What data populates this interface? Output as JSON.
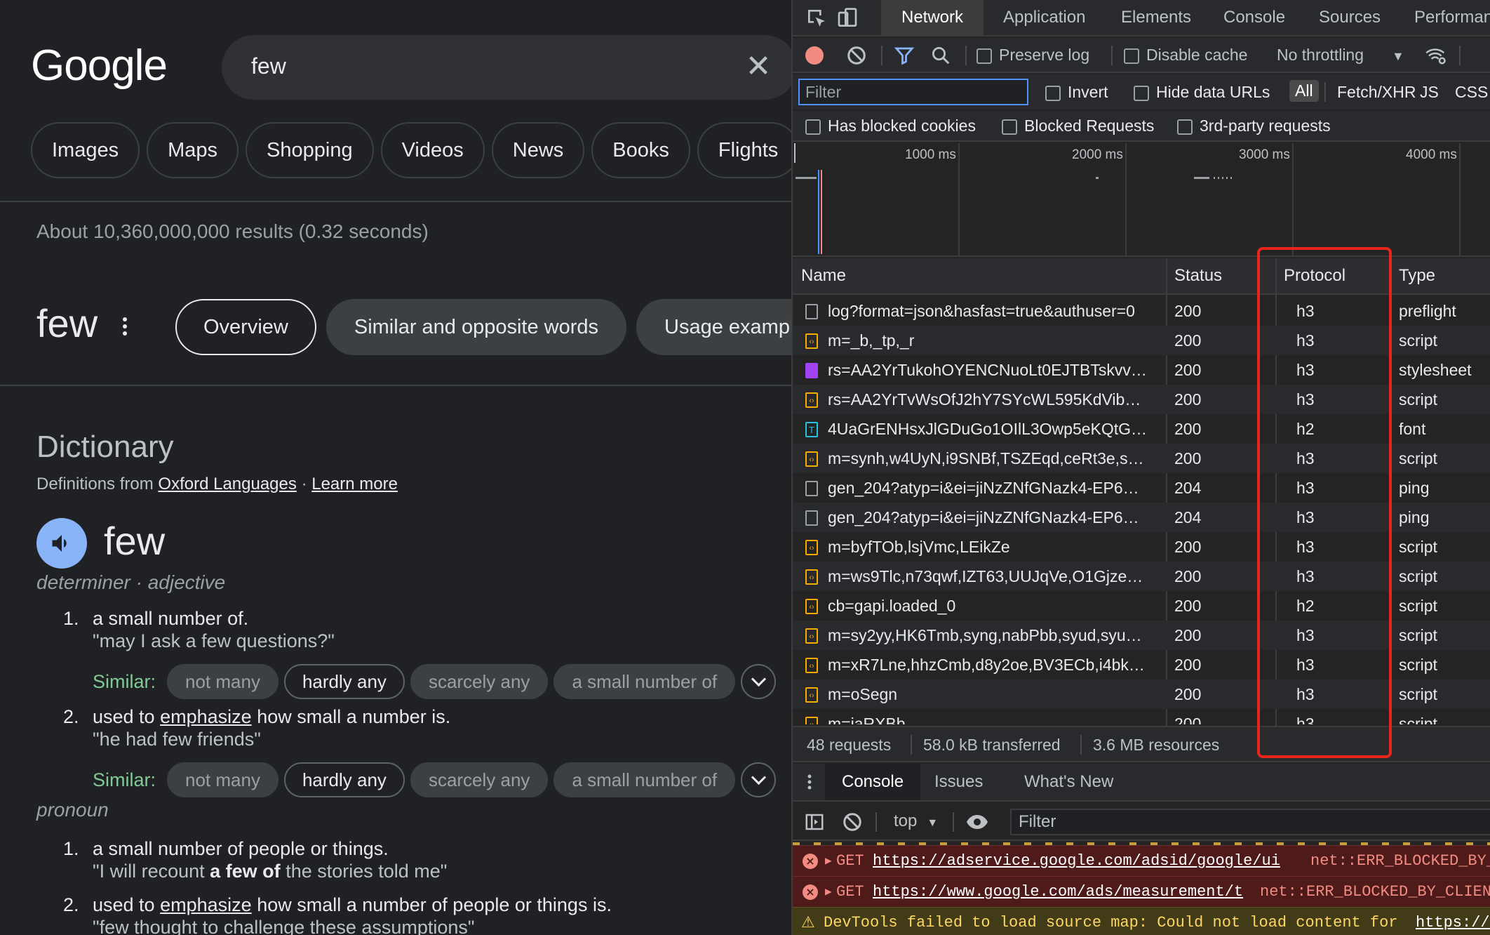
{
  "google": {
    "logo": "Google",
    "search_query": "few",
    "chips": [
      "Images",
      "Maps",
      "Shopping",
      "Videos",
      "News",
      "Books",
      "Flights"
    ],
    "stats": "About 10,360,000,000 results (0.32 seconds)",
    "term": "few",
    "term_tabs": [
      "Overview",
      "Similar and opposite words",
      "Usage examples"
    ],
    "dictionary": {
      "title": "Dictionary",
      "source_prefix": "Definitions from",
      "source_link": "Oxford Languages",
      "separator": "·",
      "learn_more": "Learn more",
      "word": "few",
      "pos1": "determiner · adjective",
      "def1_num": "1.",
      "def1": "a small number of.",
      "ex1": "\"may I ask a few questions?\"",
      "similar_label": "Similar:",
      "similar1": [
        "not many",
        "hardly any",
        "scarcely any",
        "a small number of"
      ],
      "def2_num": "2.",
      "def2_pre": "used to",
      "def2_link": "emphasize",
      "def2_post": "how small a number is.",
      "ex2": "\"he had few friends\"",
      "similar2": [
        "not many",
        "hardly any",
        "scarcely any",
        "a small number of"
      ],
      "pos2": "pronoun",
      "def3_num": "1.",
      "def3": "a small number of people or things.",
      "ex3_pre": "\"I will recount",
      "ex3_bold": "a few of",
      "ex3_post": "the stories told me\"",
      "def4_num": "2.",
      "def4_pre": "used to",
      "def4_link": "emphasize",
      "def4_post": "how small a number of people or things is.",
      "ex4": "\"few thought to challenge these assumptions\""
    }
  },
  "devtools": {
    "tabs": [
      "Network",
      "Application",
      "Elements",
      "Console",
      "Sources",
      "Performan"
    ],
    "active_tab": "Network",
    "toolbar": {
      "preserve_log": "Preserve log",
      "disable_cache": "Disable cache",
      "throttling": "No throttling"
    },
    "filter": {
      "placeholder": "Filter",
      "invert": "Invert",
      "hide_data_urls": "Hide data URLs",
      "all": "All",
      "fetch_xhr": "Fetch/XHR",
      "js": "JS",
      "css": "CSS",
      "has_blocked_cookies": "Has blocked cookies",
      "blocked_requests": "Blocked Requests",
      "third_party": "3rd-party requests"
    },
    "timeline_labels": [
      "1000 ms",
      "2000 ms",
      "3000 ms",
      "4000 ms"
    ],
    "columns": [
      "Name",
      "Status",
      "Protocol",
      "Type"
    ],
    "rows": [
      {
        "name": "log?format=json&hasfast=true&authuser=0",
        "status": "200",
        "protocol": "h3",
        "type": "preflight",
        "icon": "doc"
      },
      {
        "name": "m=_b,_tp,_r",
        "status": "200",
        "protocol": "h3",
        "type": "script",
        "icon": "script"
      },
      {
        "name": "rs=AA2YrTukohOYENCNuoLt0EJTBTskvv…",
        "status": "200",
        "protocol": "h3",
        "type": "stylesheet",
        "icon": "css"
      },
      {
        "name": "rs=AA2YrTvWsOfJ2hY7SYcWL595KdVib…",
        "status": "200",
        "protocol": "h3",
        "type": "script",
        "icon": "script"
      },
      {
        "name": "4UaGrENHsxJlGDuGo1OIlL3Owp5eKQtG…",
        "status": "200",
        "protocol": "h2",
        "type": "font",
        "icon": "font"
      },
      {
        "name": "m=synh,w4UyN,i9SNBf,TSZEqd,ceRt3e,s…",
        "status": "200",
        "protocol": "h3",
        "type": "script",
        "icon": "script"
      },
      {
        "name": "gen_204?atyp=i&ei=jiNzZNfGNazk4-EP6…",
        "status": "204",
        "protocol": "h3",
        "type": "ping",
        "icon": "doc"
      },
      {
        "name": "gen_204?atyp=i&ei=jiNzZNfGNazk4-EP6…",
        "status": "204",
        "protocol": "h3",
        "type": "ping",
        "icon": "doc"
      },
      {
        "name": "m=byfTOb,lsjVmc,LEikZe",
        "status": "200",
        "protocol": "h3",
        "type": "script",
        "icon": "script"
      },
      {
        "name": "m=ws9Tlc,n73qwf,IZT63,UUJqVe,O1Gjze…",
        "status": "200",
        "protocol": "h3",
        "type": "script",
        "icon": "script"
      },
      {
        "name": "cb=gapi.loaded_0",
        "status": "200",
        "protocol": "h2",
        "type": "script",
        "icon": "script"
      },
      {
        "name": "m=sy2yy,HK6Tmb,syng,nabPbb,syud,syu…",
        "status": "200",
        "protocol": "h3",
        "type": "script",
        "icon": "script"
      },
      {
        "name": "m=xR7Lne,hhzCmb,d8y2oe,BV3ECb,i4bk…",
        "status": "200",
        "protocol": "h3",
        "type": "script",
        "icon": "script"
      },
      {
        "name": "m=oSegn",
        "status": "200",
        "protocol": "h3",
        "type": "script",
        "icon": "script"
      },
      {
        "name": "m=iaRXBb",
        "status": "200",
        "protocol": "h3",
        "type": "script",
        "icon": "script"
      }
    ],
    "summary": {
      "requests": "48 requests",
      "transferred": "58.0 kB transferred",
      "resources": "3.6 MB resources"
    },
    "drawer_tabs": [
      "Console",
      "Issues",
      "What's New"
    ],
    "console": {
      "context": "top",
      "filter_placeholder": "Filter",
      "messages": [
        {
          "level": "error",
          "method": "GET",
          "url": "https://adservice.google.com/adsid/google/ui",
          "tail": "net::ERR_BLOCKED_BY_C"
        },
        {
          "level": "error",
          "method": "GET",
          "url": "https://www.google.com/ads/measurement/t",
          "tail": "net::ERR_BLOCKED_BY_CLIEN"
        },
        {
          "level": "warn",
          "text": "DevTools failed to load source map: Could not load content for",
          "url": "https://v"
        }
      ]
    },
    "colors": {
      "highlight_box": "#e8251b",
      "record_button": "#f28b82",
      "accent": "#4d90fe"
    }
  }
}
